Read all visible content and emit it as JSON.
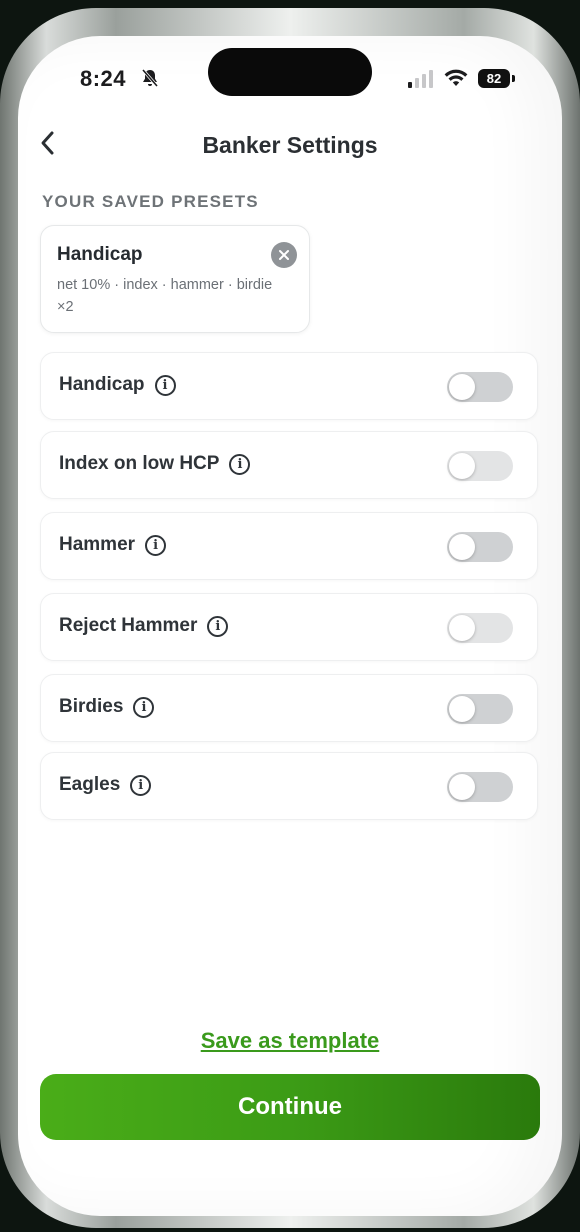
{
  "status_bar": {
    "time": "8:24",
    "battery": "82"
  },
  "header": {
    "title": "Banker Settings"
  },
  "presets": {
    "section_label": "YOUR SAVED PRESETS",
    "items": [
      {
        "name": "Handicap",
        "description": "net 10% · index · hammer · birdie ×2"
      }
    ]
  },
  "settings": [
    {
      "label": "Handicap",
      "enabled": false
    },
    {
      "label": "Index on low HCP",
      "enabled": false
    },
    {
      "label": "Hammer",
      "enabled": false
    },
    {
      "label": "Reject Hammer",
      "enabled": false
    },
    {
      "label": "Birdies",
      "enabled": false
    },
    {
      "label": "Eagles",
      "enabled": false
    }
  ],
  "info_glyph": "i",
  "actions": {
    "save_template": "Save as template",
    "continue": "Continue"
  },
  "colors": {
    "accent": "#3a9a1c",
    "button_start": "#4aad18",
    "button_end": "#2a7a0c"
  }
}
